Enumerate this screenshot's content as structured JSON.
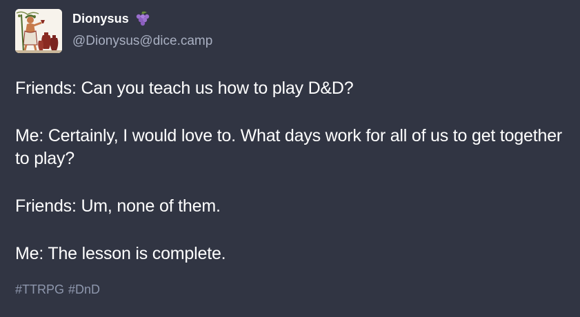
{
  "author": {
    "display_name": "Dionysus",
    "handle": "@Dionysus@dice.camp",
    "emoji_icon": "grapes-icon"
  },
  "post": {
    "paragraphs": [
      "Friends: Can you teach us how to play D&D?",
      "Me: Certainly, I would love to. What days work for all of us to get together to play?",
      "Friends: Um, none of them.",
      "Me: The lesson is complete."
    ],
    "hashtags": [
      "#TTRPG",
      "#DnD"
    ]
  },
  "colors": {
    "background": "#313543",
    "text": "#ffffff",
    "handle": "#a9b0c2",
    "hashtag": "#8e97ad"
  }
}
